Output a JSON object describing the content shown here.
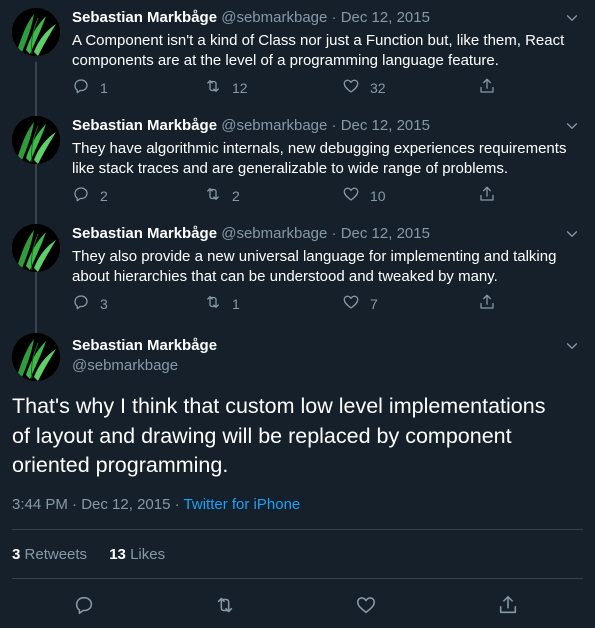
{
  "thread": [
    {
      "name": "Sebastian Markbåge",
      "handle": "@sebmarkbage",
      "separator": "·",
      "date": "Dec 12, 2015",
      "line1": "A Component isn't a kind of Class nor just a Function but, like them, React",
      "line2": "components are at the level of a programming language feature.",
      "replies": "1",
      "retweets": "12",
      "likes": "32"
    },
    {
      "name": "Sebastian Markbåge",
      "handle": "@sebmarkbage",
      "separator": "·",
      "date": "Dec 12, 2015",
      "line1": "They have algorithmic internals, new debugging experiences requirements",
      "line2": "like stack traces and are generalizable to wide range of problems.",
      "replies": "2",
      "retweets": "2",
      "likes": "10"
    },
    {
      "name": "Sebastian Markbåge",
      "handle": "@sebmarkbage",
      "separator": "·",
      "date": "Dec 12, 2015",
      "line1": "They also provide a new universal language for implementing and talking",
      "line2": "about hierarchies that can be understood and tweaked by many.",
      "replies": "3",
      "retweets": "1",
      "likes": "7"
    }
  ],
  "main": {
    "name": "Sebastian Markbåge",
    "handle": "@sebmarkbage",
    "line1": "That's why I think that custom low level implementations",
    "line2": "of layout and drawing will be replaced by component",
    "line3": "oriented programming.",
    "time": "3:44 PM",
    "separator": "·",
    "date": "Dec 12, 2015",
    "source": "Twitter for iPhone",
    "retweets_count": "3",
    "retweets_label": "Retweets",
    "likes_count": "13",
    "likes_label": "Likes"
  },
  "colors": {
    "background": "#15202b",
    "text": "#ffffff",
    "secondary": "#8899a6",
    "link": "#1da1f2",
    "divider": "#38444d"
  },
  "icons": {
    "reply": "reply-icon",
    "retweet": "retweet-icon",
    "like": "heart-icon",
    "share": "share-icon",
    "more": "chevron-down-icon"
  }
}
